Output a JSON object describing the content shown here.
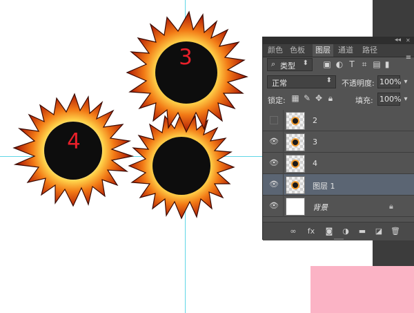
{
  "canvas": {
    "suns": [
      {
        "label": "3"
      },
      {
        "label": "4"
      },
      {
        "label": ""
      }
    ]
  },
  "panel": {
    "tabs": [
      {
        "label": "颜色",
        "active": false
      },
      {
        "label": "色板",
        "active": false
      },
      {
        "label": "图层",
        "active": true
      },
      {
        "label": "通道",
        "active": false
      },
      {
        "label": "路径",
        "active": false
      }
    ],
    "filter": {
      "label": "类型"
    },
    "blend_mode": "正常",
    "opacity_label": "不透明度:",
    "opacity_value": "100%",
    "lock_label": "锁定:",
    "fill_label": "填充:",
    "fill_value": "100%",
    "layers": [
      {
        "name": "2",
        "visible": false,
        "selected": false,
        "thumb": "fire",
        "locked": false
      },
      {
        "name": "3",
        "visible": true,
        "selected": false,
        "thumb": "fire",
        "locked": false
      },
      {
        "name": "4",
        "visible": true,
        "selected": false,
        "thumb": "fire",
        "locked": false
      },
      {
        "name": "图层 1",
        "visible": true,
        "selected": true,
        "thumb": "fire",
        "locked": false
      },
      {
        "name": "背景",
        "visible": true,
        "selected": false,
        "thumb": "white",
        "locked": true
      }
    ],
    "footer_icons": [
      "link-icon",
      "fx-icon",
      "mask-icon",
      "adjustment-icon",
      "folder-icon",
      "new-layer-icon",
      "trash-icon"
    ]
  },
  "colors": {
    "panel_bg": "#535353",
    "selected_row": "#5b6573",
    "guide": "#5fd6e6",
    "number_red": "#e8202a",
    "pink_overlay": "#fbb3c5"
  }
}
